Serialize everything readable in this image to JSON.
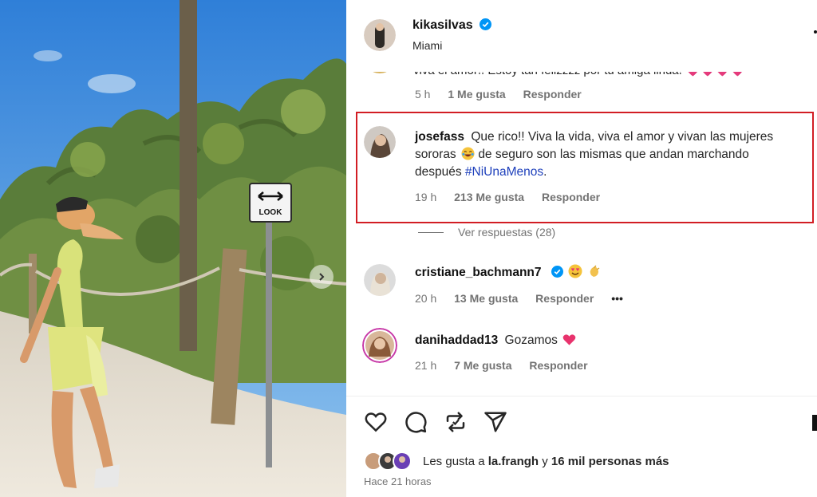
{
  "post": {
    "author": "kikasilvas",
    "location": "Miami",
    "sign_text": "LOOK",
    "time_ago": "Hace 21 horas"
  },
  "comments": {
    "partial": {
      "text": "viva el amor!! Estoy tan felizzzz por tu amiga linda! 💗💗💗💗",
      "time": "5 h",
      "likes": "1 Me gusta",
      "reply": "Responder"
    },
    "highlighted": {
      "username": "josefass",
      "line1": "Que rico!! Viva la vida, viva el amor y vivan las mujeres",
      "line2a": "sororas",
      "line2b": "de seguro son las mismas que andan marchando",
      "line3a": "después",
      "hashtag": "#NiUnaMenos",
      "line3b": ".",
      "time": "19 h",
      "likes": "213 Me gusta",
      "reply": "Responder",
      "view_replies": "Ver respuestas (28)"
    },
    "c3": {
      "username": "cristiane_bachmann7",
      "time": "20 h",
      "likes": "13 Me gusta",
      "reply": "Responder",
      "more": "•••"
    },
    "c4": {
      "username": "danihaddad13",
      "text": "Gozamos",
      "time": "21 h",
      "likes": "7 Me gusta",
      "reply": "Responder"
    }
  },
  "likes": {
    "prefix": "Les gusta a",
    "user": "la.frangh",
    "connector": "y",
    "others": "16 mil personas más"
  },
  "colors": {
    "highlight_border": "#d21d24",
    "verified": "#0095f6",
    "hashtag": "#1d3fbb",
    "heart": "#e8336d"
  },
  "icons": [
    "heart-icon",
    "comment-icon",
    "repost-icon",
    "share-icon",
    "verified-icon",
    "chevron-right-icon",
    "more-icon"
  ]
}
